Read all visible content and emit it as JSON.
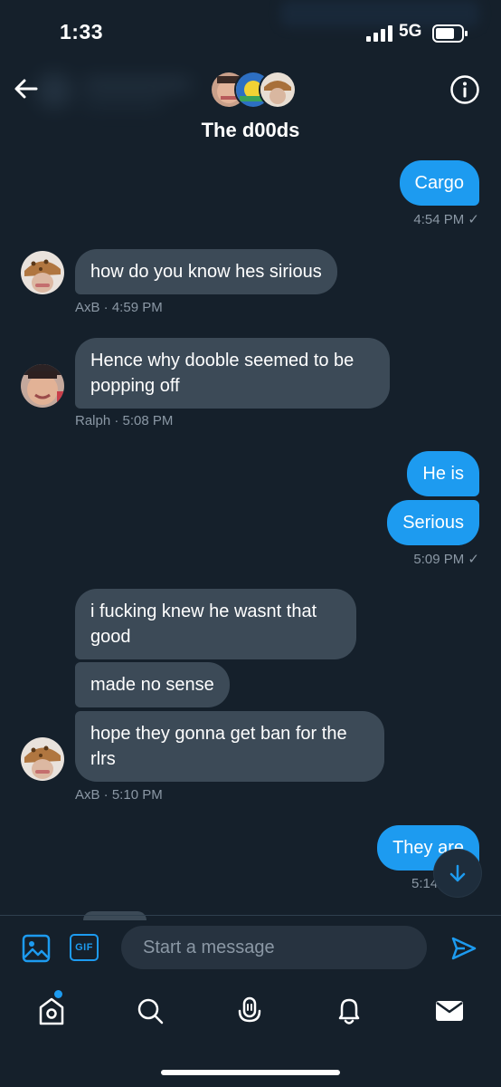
{
  "status_bar": {
    "time": "1:33",
    "network": "5G"
  },
  "header": {
    "title": "The d00ds"
  },
  "messages": [
    {
      "direction": "out",
      "text": "Cargo",
      "meta": "4:54 PM ✓"
    },
    {
      "direction": "in",
      "text": "how do you know hes sirious",
      "sender": "AxB",
      "meta": "AxB · 4:59 PM"
    },
    {
      "direction": "in",
      "text": "Hence why dooble seemed to be popping off",
      "sender": "Ralph",
      "meta": "Ralph · 5:08 PM"
    },
    {
      "direction": "out",
      "text": "He is"
    },
    {
      "direction": "out",
      "text": "Serious",
      "meta": "5:09 PM ✓"
    },
    {
      "direction": "in",
      "text": "i fucking knew he wasnt that good",
      "sender": "AxB"
    },
    {
      "direction": "in",
      "text": "made no sense",
      "sender": "AxB"
    },
    {
      "direction": "in",
      "text": "hope they gonna get ban for the rlrs",
      "sender": "AxB",
      "meta": "AxB · 5:10 PM"
    },
    {
      "direction": "out",
      "text": "They are",
      "meta": "5:14"
    }
  ],
  "composer": {
    "placeholder": "Start a message",
    "gif_label": "GIF"
  },
  "tab_bar": [
    "home-icon",
    "search-icon",
    "spaces-icon",
    "notifications-icon",
    "messages-icon"
  ],
  "colors": {
    "background": "#15202b",
    "accent": "#1d9bf0",
    "incoming_bubble": "#3c4a57",
    "meta": "#8b98a5"
  }
}
